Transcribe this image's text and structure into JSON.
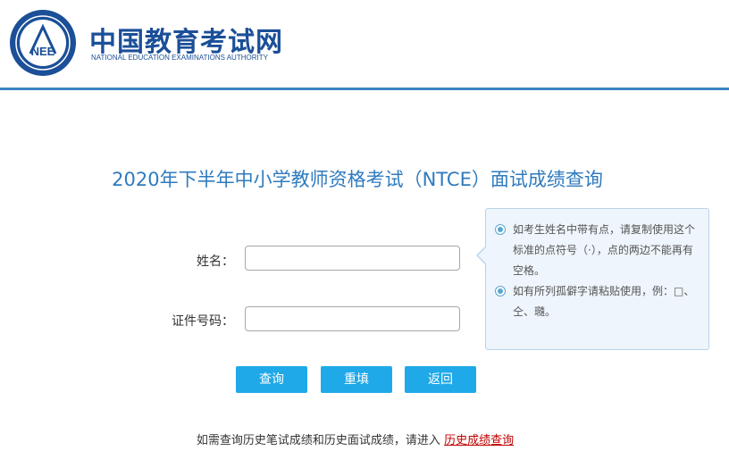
{
  "header": {
    "logo_text": "NEE",
    "site_name_cn": "中国教育考试网",
    "site_name_en": "NATIONAL EDUCATION EXAMINATIONS AUTHORITY",
    "accent_color": "#3a84c6"
  },
  "page": {
    "title": "2020年下半年中小学教师资格考试（NTCE）面试成绩查询"
  },
  "form": {
    "name_label": "姓名：",
    "name_value": "",
    "id_label": "证件号码：",
    "id_value": ""
  },
  "tips": [
    "如考生姓名中带有点，请复制使用这个标准的点符号（·），点的两边不能再有空格。",
    "如有所列孤僻字请粘贴使用，例：□、仝、瓍。"
  ],
  "buttons": {
    "query": "查询",
    "reset": "重填",
    "back": "返回",
    "color": "#20a9e8"
  },
  "footer": {
    "text": "如需查询历史笔试成绩和历史面试成绩，请进入",
    "link_text": "历史成绩查询"
  }
}
